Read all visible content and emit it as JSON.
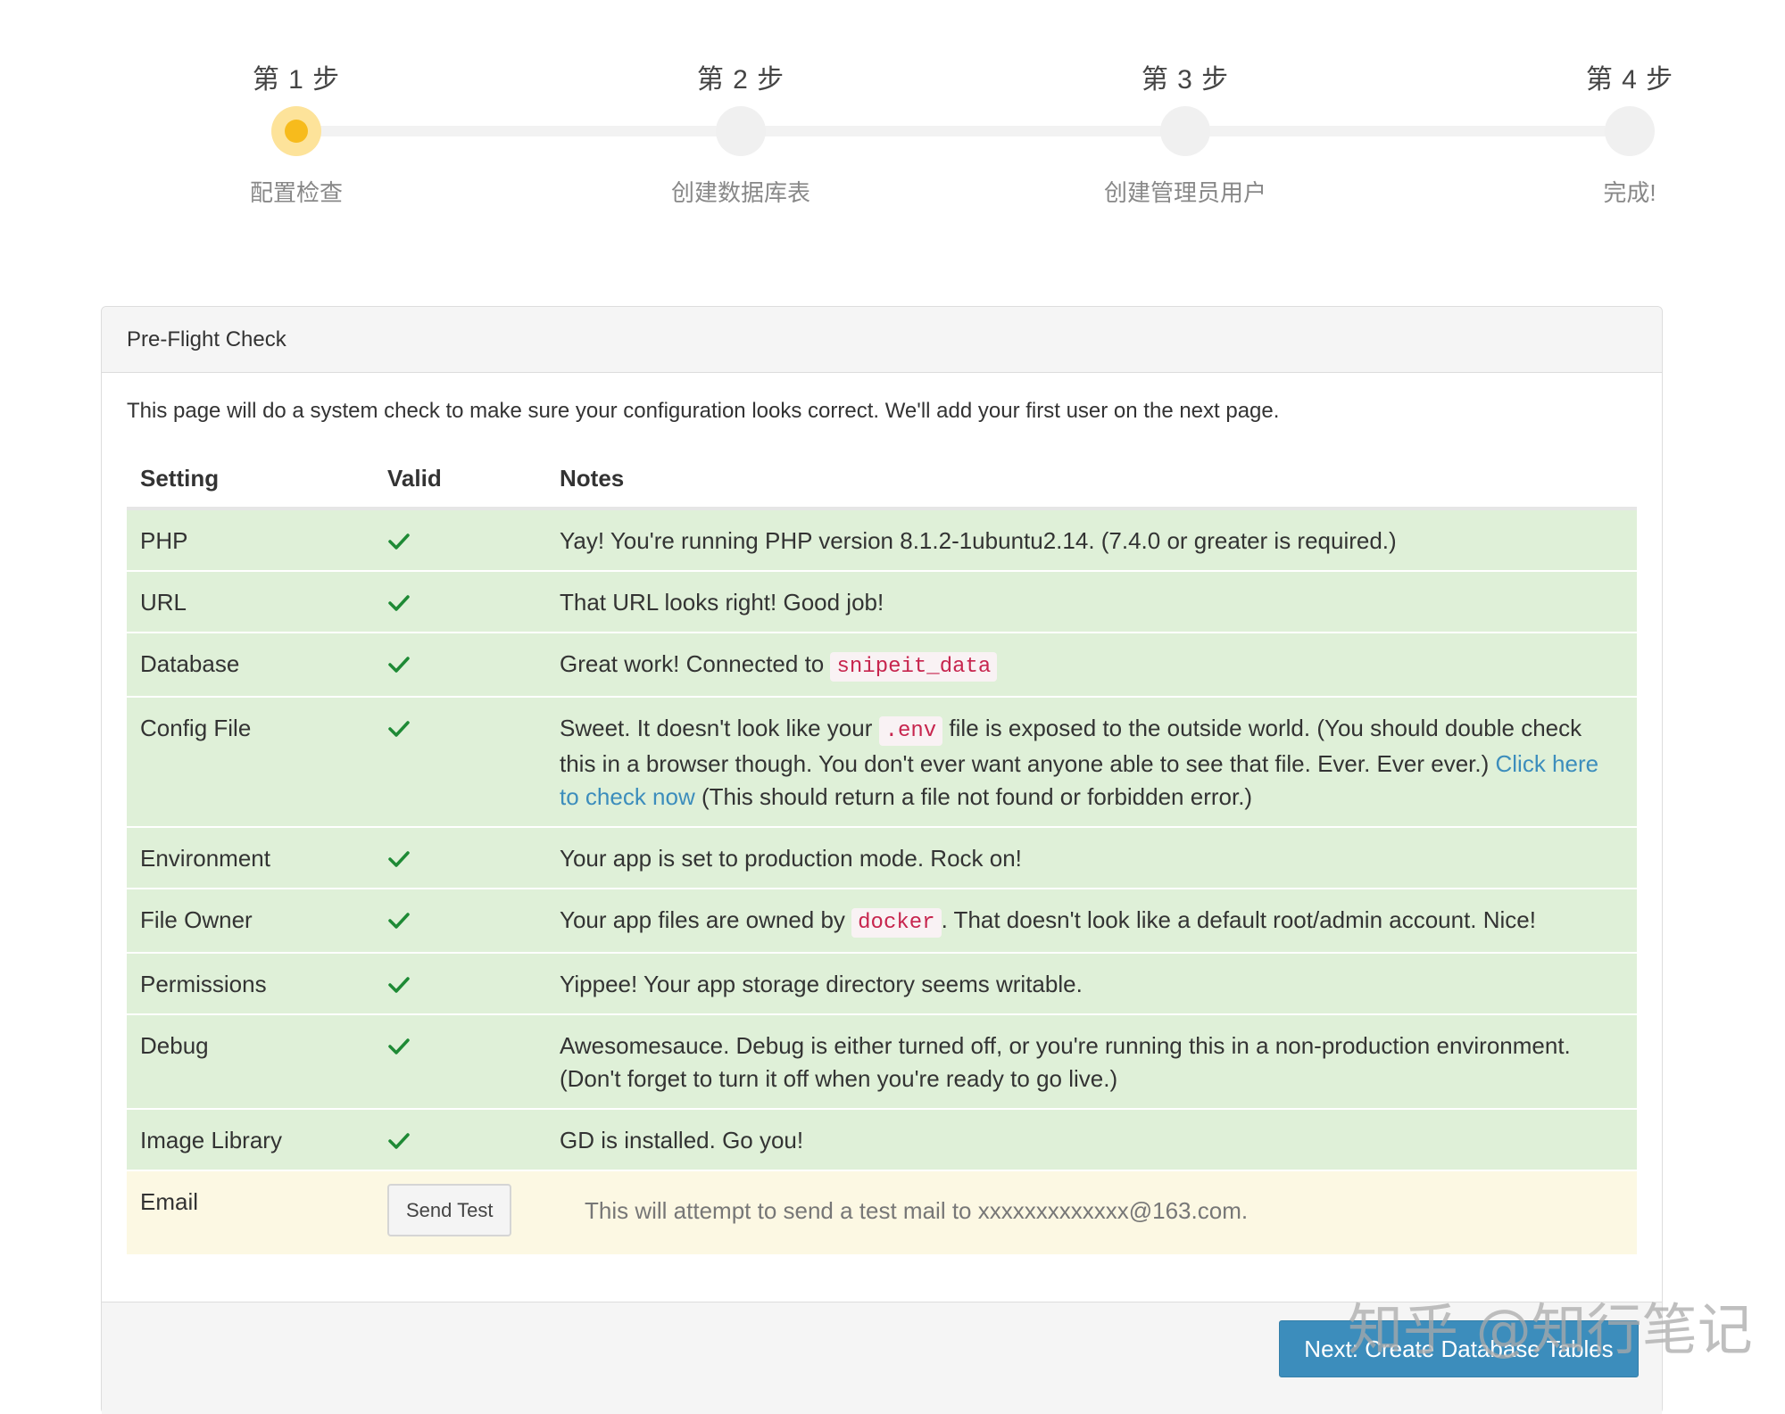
{
  "stepper": {
    "steps": [
      {
        "title": "第 1 步",
        "label": "配置检查",
        "active": true
      },
      {
        "title": "第 2 步",
        "label": "创建数据库表",
        "active": false
      },
      {
        "title": "第 3 步",
        "label": "创建管理员用户",
        "active": false
      },
      {
        "title": "第 4 步",
        "label": "完成!",
        "active": false
      }
    ]
  },
  "panel": {
    "heading": "Pre-Flight Check",
    "intro": "This page will do a system check to make sure your configuration looks correct. We'll add your first user on the next page.",
    "columns": {
      "setting": "Setting",
      "valid": "Valid",
      "notes": "Notes"
    },
    "rows": [
      {
        "setting": "PHP",
        "valid": "check-icon",
        "note": "Yay! You're running PHP version 8.1.2-1ubuntu2.14. (7.4.0 or greater is required.)"
      },
      {
        "setting": "URL",
        "valid": "check-icon",
        "note": "That URL looks right! Good job!"
      },
      {
        "setting": "Database",
        "valid": "check-icon",
        "note_before": "Great work! Connected to ",
        "code": "snipeit_data"
      },
      {
        "setting": "Config File",
        "valid": "check-icon",
        "note_before": "Sweet. It doesn't look like your ",
        "code": ".env",
        "note_middle": " file is exposed to the outside world. (You should double check this in a browser though. You don't ever want anyone able to see that file. Ever. Ever ever.) ",
        "link": "Click here to check now",
        "note_after": " (This should return a file not found or forbidden error.)"
      },
      {
        "setting": "Environment",
        "valid": "check-icon",
        "note": "Your app is set to production mode. Rock on!"
      },
      {
        "setting": "File Owner",
        "valid": "check-icon",
        "note_before": "Your app files are owned by ",
        "code": "docker",
        "note_after": ". That doesn't look like a default root/admin account. Nice!"
      },
      {
        "setting": "Permissions",
        "valid": "check-icon",
        "note": "Yippee! Your app storage directory seems writable."
      },
      {
        "setting": "Debug",
        "valid": "check-icon",
        "note": "Awesomesauce. Debug is either turned off, or you're running this in a non-production environment. (Don't forget to turn it off when you're ready to go live.)"
      },
      {
        "setting": "Image Library",
        "valid": "check-icon",
        "note": "GD is installed. Go you!"
      }
    ],
    "email": {
      "setting": "Email",
      "button": "Send Test",
      "note": "This will attempt to send a test mail to xxxxxxxxxxxxx@163.com."
    },
    "next_button": "Next: Create Database Tables"
  },
  "watermark": "知乎 @知行笔记",
  "colors": {
    "ok_row": "#dff0d8",
    "warn_row": "#fcf8e3",
    "check": "#1e8a35",
    "primary": "#3c8dbc",
    "code": "#c7254e",
    "active_step": "#f7bb1c"
  }
}
